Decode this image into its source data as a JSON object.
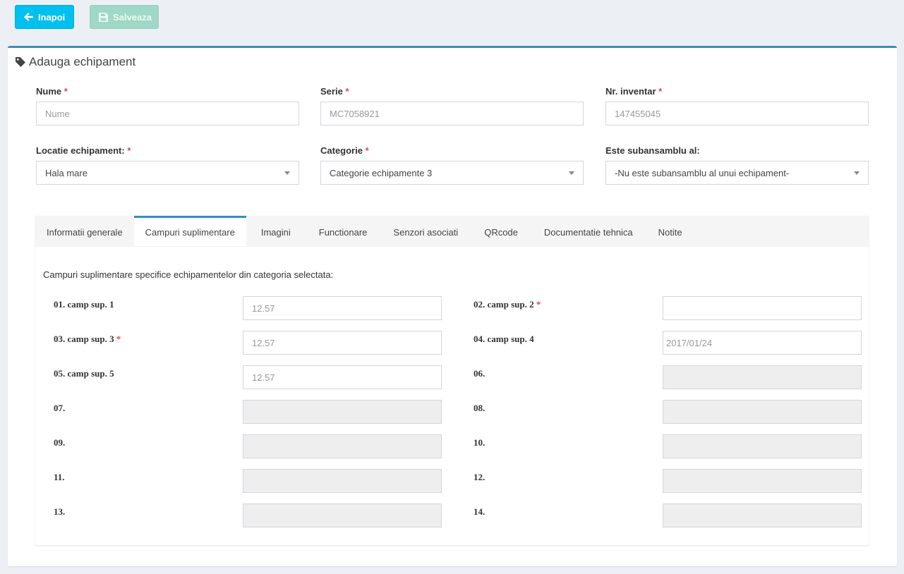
{
  "toolbar": {
    "back_label": "Inapoi",
    "save_label": "Salveaza"
  },
  "box": {
    "title": "Adauga echipament"
  },
  "form": {
    "nume": {
      "label": "Nume",
      "required": "*",
      "placeholder": "Nume",
      "value": ""
    },
    "serie": {
      "label": "Serie",
      "required": "*",
      "value": "MC7058921"
    },
    "nr_inventar": {
      "label": "Nr. inventar",
      "required": "*",
      "value": "147455045"
    },
    "locatie": {
      "label": "Locatie echipament:",
      "required": "*",
      "selected": "Hala mare"
    },
    "categorie": {
      "label": "Categorie",
      "required": "*",
      "selected": "Categorie echipamente 3"
    },
    "subansamblu": {
      "label": "Este subansamblu al:",
      "selected": "-Nu este subansamblu al unui echipament-"
    }
  },
  "tabs": [
    {
      "label": "Informatii generale"
    },
    {
      "label": "Campuri suplimentare"
    },
    {
      "label": "Imagini"
    },
    {
      "label": "Functionare"
    },
    {
      "label": "Senzori asociati"
    },
    {
      "label": "QRcode"
    },
    {
      "label": "Documentatie tehnica"
    },
    {
      "label": "Notite"
    }
  ],
  "tab_content": {
    "description": "Campuri suplimentare specifice echipamentelor din categoria selectata:",
    "fields": [
      {
        "label": "01. camp sup. 1",
        "required": "",
        "value": "12.57"
      },
      {
        "label": "02. camp sup. 2",
        "required": "*",
        "value": ""
      },
      {
        "label": "03. camp sup. 3",
        "required": "*",
        "value": "12.57"
      },
      {
        "label": "04. camp sup. 4",
        "required": "",
        "value": "2017/01/24"
      },
      {
        "label": "05. camp sup. 5",
        "required": "",
        "value": "12.57"
      },
      {
        "label": "06.",
        "required": "",
        "value": ""
      },
      {
        "label": "07.",
        "required": "",
        "value": ""
      },
      {
        "label": "08.",
        "required": "",
        "value": ""
      },
      {
        "label": "09.",
        "required": "",
        "value": ""
      },
      {
        "label": "10.",
        "required": "",
        "value": ""
      },
      {
        "label": "11.",
        "required": "",
        "value": ""
      },
      {
        "label": "12.",
        "required": "",
        "value": ""
      },
      {
        "label": "13.",
        "required": "",
        "value": ""
      },
      {
        "label": "14.",
        "required": "",
        "value": ""
      }
    ]
  },
  "colors": {
    "accent": "#3c8dbc",
    "back_button": "#00c0ef",
    "save_button": "#9fd8c6",
    "required": "#dd4b39"
  }
}
